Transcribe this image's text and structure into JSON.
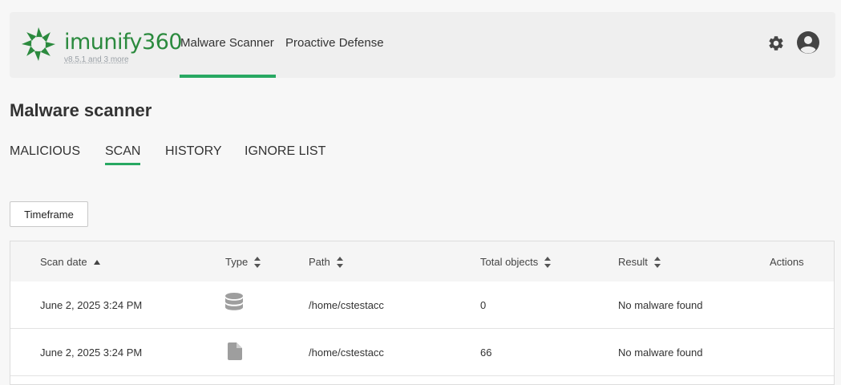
{
  "header": {
    "brand": "imunify360",
    "version": "v8.5.1 and 3 more",
    "nav": [
      {
        "label": "Malware Scanner",
        "active": true
      },
      {
        "label": "Proactive Defense",
        "active": false
      }
    ],
    "icons": [
      "gear-icon",
      "user-avatar-icon"
    ],
    "accent_color": "#28a862",
    "brand_color": "#2b8a3e"
  },
  "page": {
    "title": "Malware scanner",
    "tabs": [
      {
        "label": "MALICIOUS",
        "active": false
      },
      {
        "label": "SCAN",
        "active": true
      },
      {
        "label": "HISTORY",
        "active": false
      },
      {
        "label": "IGNORE LIST",
        "active": false
      }
    ],
    "timeframe_label": "Timeframe"
  },
  "table": {
    "columns": [
      {
        "label": "Scan date",
        "sort": "asc"
      },
      {
        "label": "Type",
        "sort": "both"
      },
      {
        "label": "Path",
        "sort": "both"
      },
      {
        "label": "Total objects",
        "sort": "both"
      },
      {
        "label": "Result",
        "sort": "both"
      },
      {
        "label": "Actions",
        "sort": "none"
      }
    ],
    "rows": [
      {
        "scan_date": "June 2, 2025 3:24 PM",
        "type_icon": "database-icon",
        "path": "/home/cstestacc",
        "total_objects": "0",
        "result": "No malware found"
      },
      {
        "scan_date": "June 2, 2025 3:24 PM",
        "type_icon": "file-icon",
        "path": "/home/cstestacc",
        "total_objects": "66",
        "result": "No malware found"
      }
    ]
  }
}
